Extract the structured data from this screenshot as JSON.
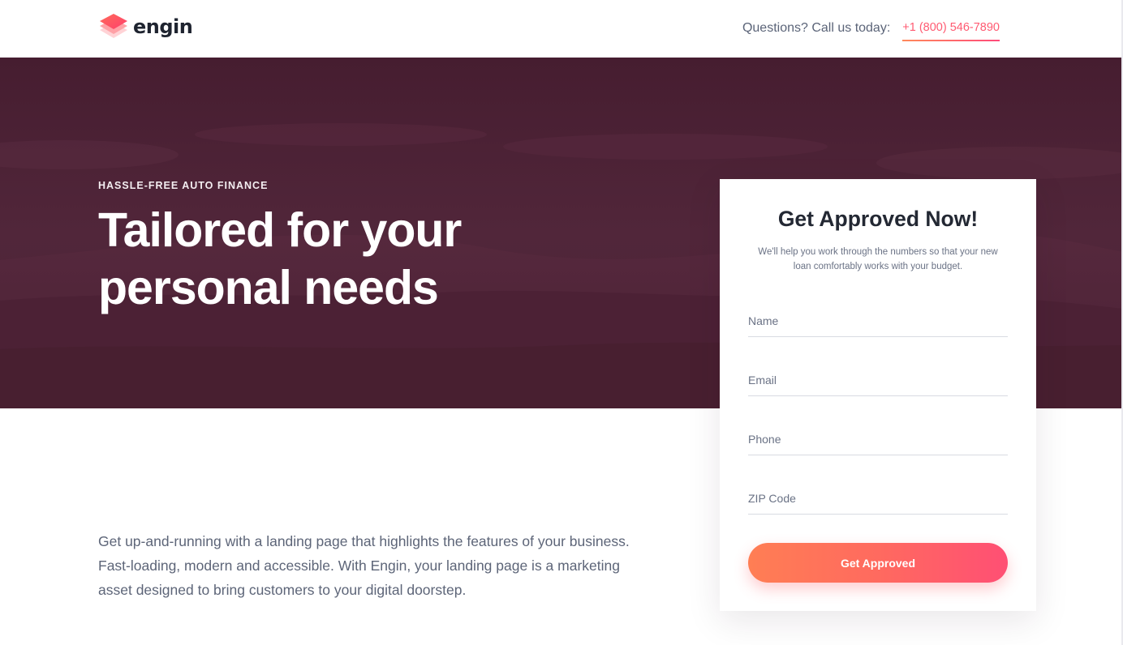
{
  "brand": {
    "name": "engin",
    "colors": {
      "accent_start": "#ff8a5b",
      "accent_end": "#ff4a7a",
      "hero_bg": "#4d2337"
    }
  },
  "header": {
    "contact_label": "Questions? Call us today:",
    "phone": "+1 (800) 546-7890"
  },
  "hero": {
    "eyebrow": "HASSLE-FREE AUTO FINANCE",
    "headline": "Tailored for your personal needs"
  },
  "main": {
    "body": "Get up-and-running with a landing page that highlights the features of your business. Fast-loading, modern and accessible. With Engin, your landing page is a marketing asset designed to bring customers to your digital doorstep."
  },
  "form": {
    "title": "Get Approved Now!",
    "subtitle": "We'll help you work through the numbers so that your new loan comfortably works with your budget.",
    "fields": [
      {
        "placeholder": "Name",
        "value": ""
      },
      {
        "placeholder": "Email",
        "value": ""
      },
      {
        "placeholder": "Phone",
        "value": ""
      },
      {
        "placeholder": "ZIP Code",
        "value": ""
      }
    ],
    "submit_label": "Get Approved"
  },
  "icons": {
    "logo": "stacked-diamond-icon"
  }
}
